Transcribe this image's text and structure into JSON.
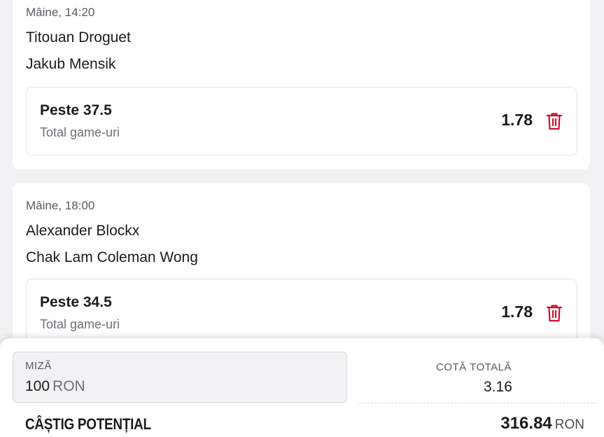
{
  "bets": [
    {
      "datetime": "Mâine, 14:20",
      "player1": "Titouan Droguet",
      "player2": "Jakub Mensik",
      "selection": "Peste 37.5",
      "market": "Total game-uri",
      "odd": "1.78"
    },
    {
      "datetime": "Mâine, 18:00",
      "player1": "Alexander Blockx",
      "player2": "Chak Lam Coleman Wong",
      "selection": "Peste 34.5",
      "market": "Total game-uri",
      "odd": "1.78"
    }
  ],
  "slip": {
    "stake_label": "MIZĂ",
    "stake_value": "100",
    "stake_currency": "RON",
    "total_odds_label": "COTĂ TOTALĂ",
    "total_odds_value": "3.16",
    "potential_win_label": "CÂȘTIG POTENȚIAL",
    "potential_win_value": "316.84",
    "potential_win_currency": "RON"
  },
  "icons": {
    "delete": "trash-icon"
  },
  "colors": {
    "delete_icon": "#c8102e",
    "background": "#f1f2f3",
    "card": "#ffffff"
  }
}
